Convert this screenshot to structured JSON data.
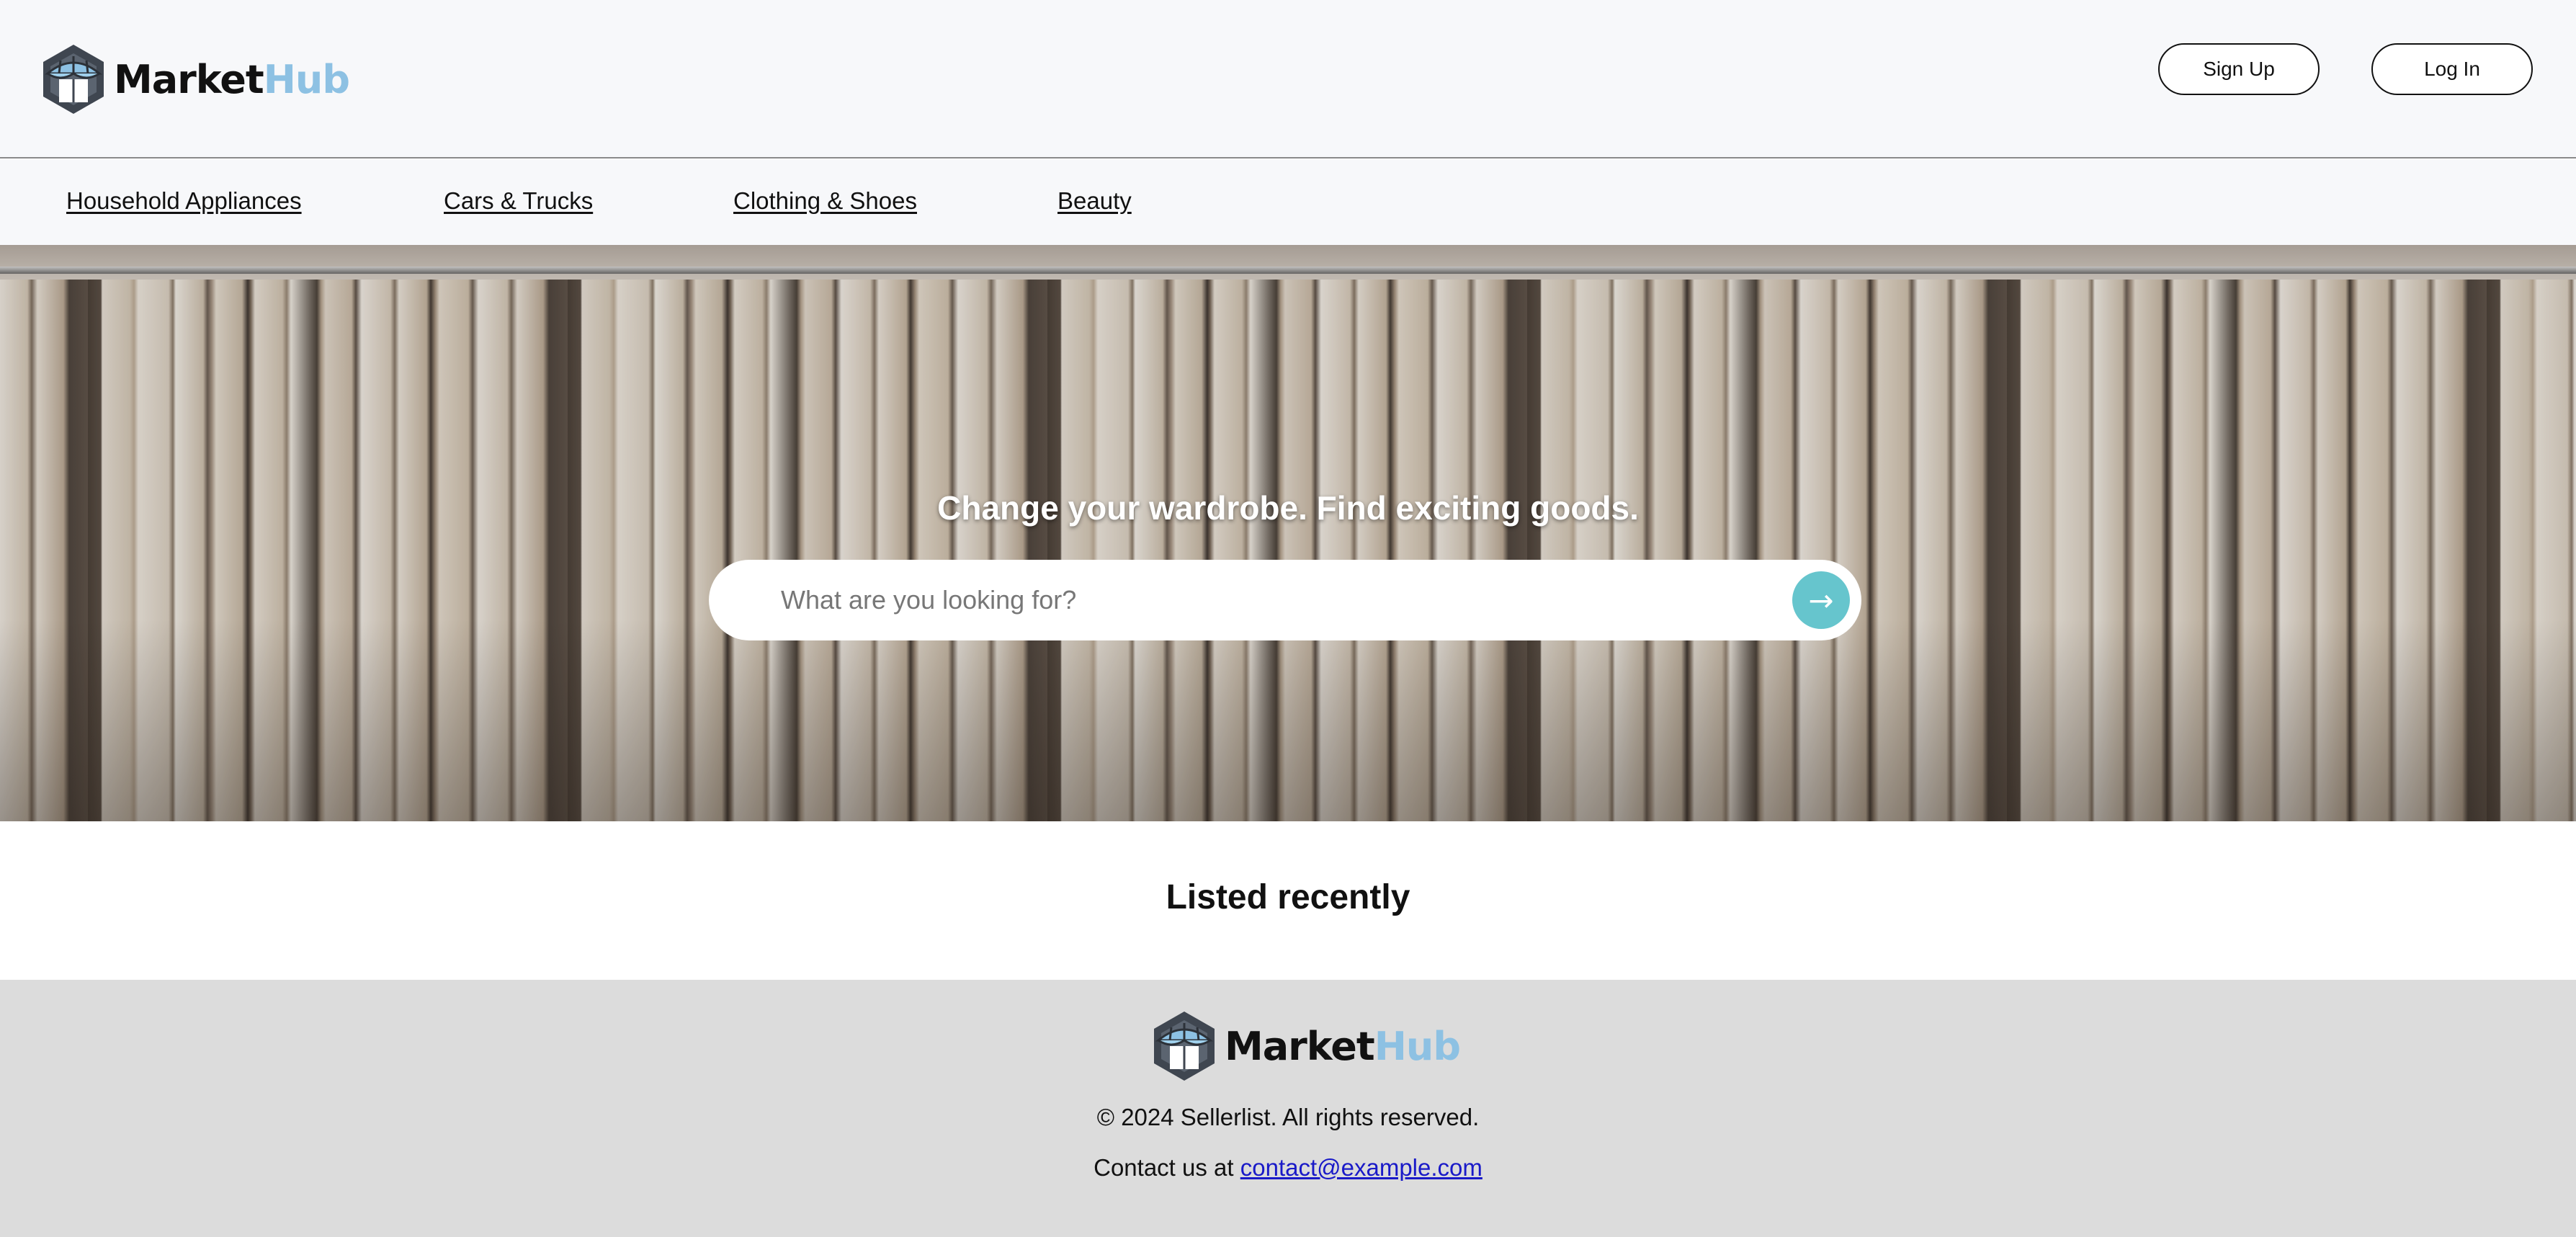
{
  "brand": {
    "name_part1": "Market",
    "name_part2": "Hub",
    "accent_color": "#8dc1e3",
    "icon": "market-stall-logo-icon"
  },
  "header": {
    "signup_label": "Sign Up",
    "login_label": "Log In"
  },
  "nav": {
    "items": [
      {
        "label": "Household Appliances"
      },
      {
        "label": "Cars & Trucks"
      },
      {
        "label": "Clothing & Shoes"
      },
      {
        "label": "Beauty"
      }
    ]
  },
  "hero": {
    "title": "Change your wardrobe. Find exciting goods.",
    "search_placeholder": "What are you looking for?",
    "search_button_icon": "arrow-right-icon",
    "search_button_color": "#66c5cd",
    "background": "clothing-rack-photo"
  },
  "listed": {
    "heading": "Listed recently"
  },
  "footer": {
    "copyright": "© 2024 Sellerlist. All rights reserved.",
    "contact_prefix": "Contact us at ",
    "contact_email": "contact@example.com"
  }
}
